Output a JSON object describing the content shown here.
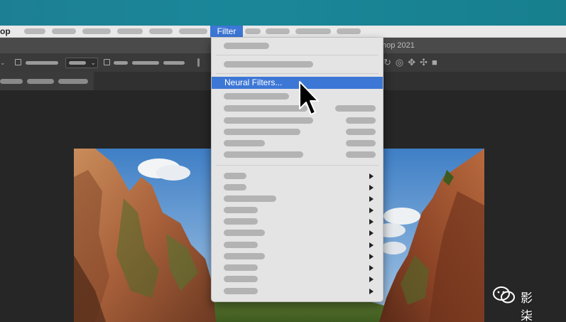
{
  "menubar": {
    "app_name_fragment": "op",
    "active_menu": "Filter"
  },
  "window": {
    "title_fragment": "hop 2021"
  },
  "filter_menu": {
    "highlighted_item": "Neural Filters...",
    "submenu_indicator": "▶"
  },
  "watermark": {
    "text": "影柒"
  },
  "colors": {
    "menu_highlight": "#3d77d6",
    "menubar_bg": "#e9e9e9",
    "dropdown_bg": "#e4e4e4",
    "app_bg": "#2f2f2f"
  }
}
